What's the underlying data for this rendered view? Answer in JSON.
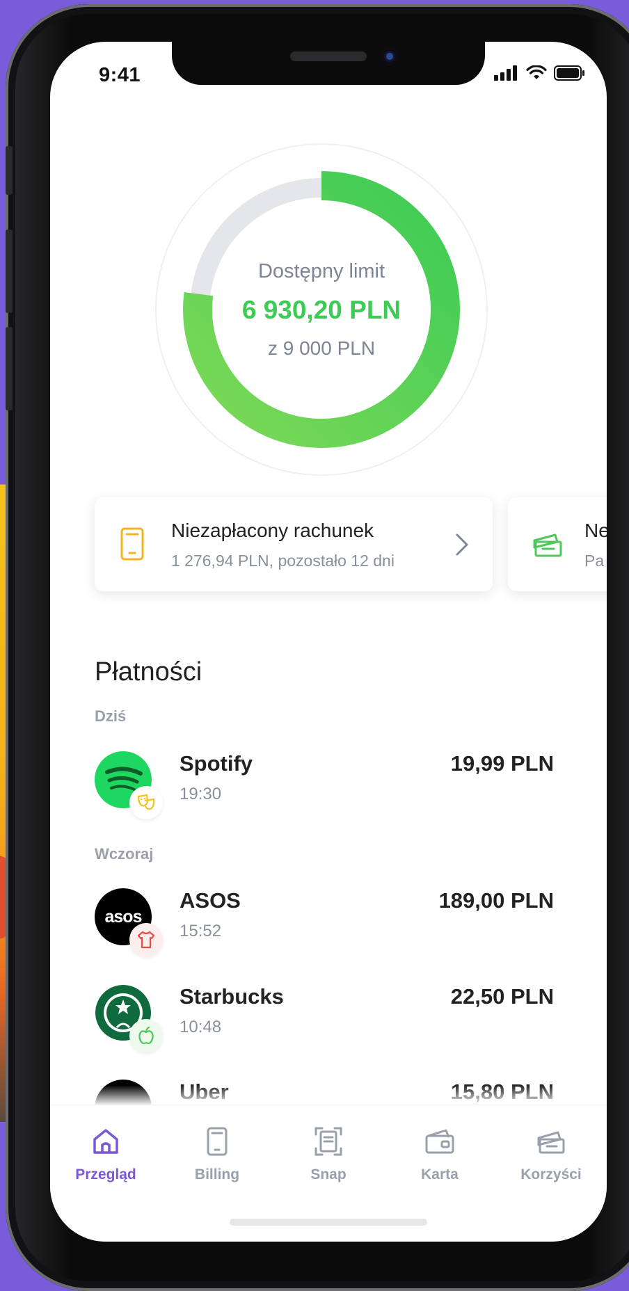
{
  "status_bar": {
    "time": "9:41"
  },
  "limit": {
    "label": "Dostępny limit",
    "amount": "6 930,20 PLN",
    "total": "z 9 000 PLN",
    "available_fraction": 0.77
  },
  "cards": [
    {
      "title": "Niezapłacony rachunek",
      "subtitle": "1 276,94 PLN, pozostało 12 dni",
      "icon": "bill-icon"
    },
    {
      "title": "Ne",
      "subtitle": "Pa",
      "icon": "ticket-icon"
    }
  ],
  "payments": {
    "title": "Płatności",
    "groups": [
      {
        "label": "Dziś",
        "items": [
          {
            "name": "Spotify",
            "time": "19:30",
            "amount": "19,99 PLN",
            "logo": "spotify-logo",
            "category_icon": "theatre-masks-icon"
          }
        ]
      },
      {
        "label": "Wczoraj",
        "items": [
          {
            "name": "ASOS",
            "time": "15:52",
            "amount": "189,00 PLN",
            "logo": "asos-logo",
            "category_icon": "tshirt-icon"
          },
          {
            "name": "Starbucks",
            "time": "10:48",
            "amount": "22,50 PLN",
            "logo": "starbucks-logo",
            "category_icon": "apple-icon"
          },
          {
            "name": "Uber",
            "time": "",
            "amount": "15,80 PLN",
            "logo": "uber-logo",
            "category_icon": ""
          }
        ]
      }
    ]
  },
  "tabs": [
    {
      "label": "Przegląd",
      "icon": "home-icon",
      "active": true
    },
    {
      "label": "Billing",
      "icon": "phone-icon",
      "active": false
    },
    {
      "label": "Snap",
      "icon": "scan-icon",
      "active": false
    },
    {
      "label": "Karta",
      "icon": "card-icon",
      "active": false
    },
    {
      "label": "Korzyści",
      "icon": "ticket-icon",
      "active": false
    }
  ],
  "colors": {
    "accent": "#7b57d6",
    "green": "#3ccb55",
    "background": "#7a5bd9"
  }
}
